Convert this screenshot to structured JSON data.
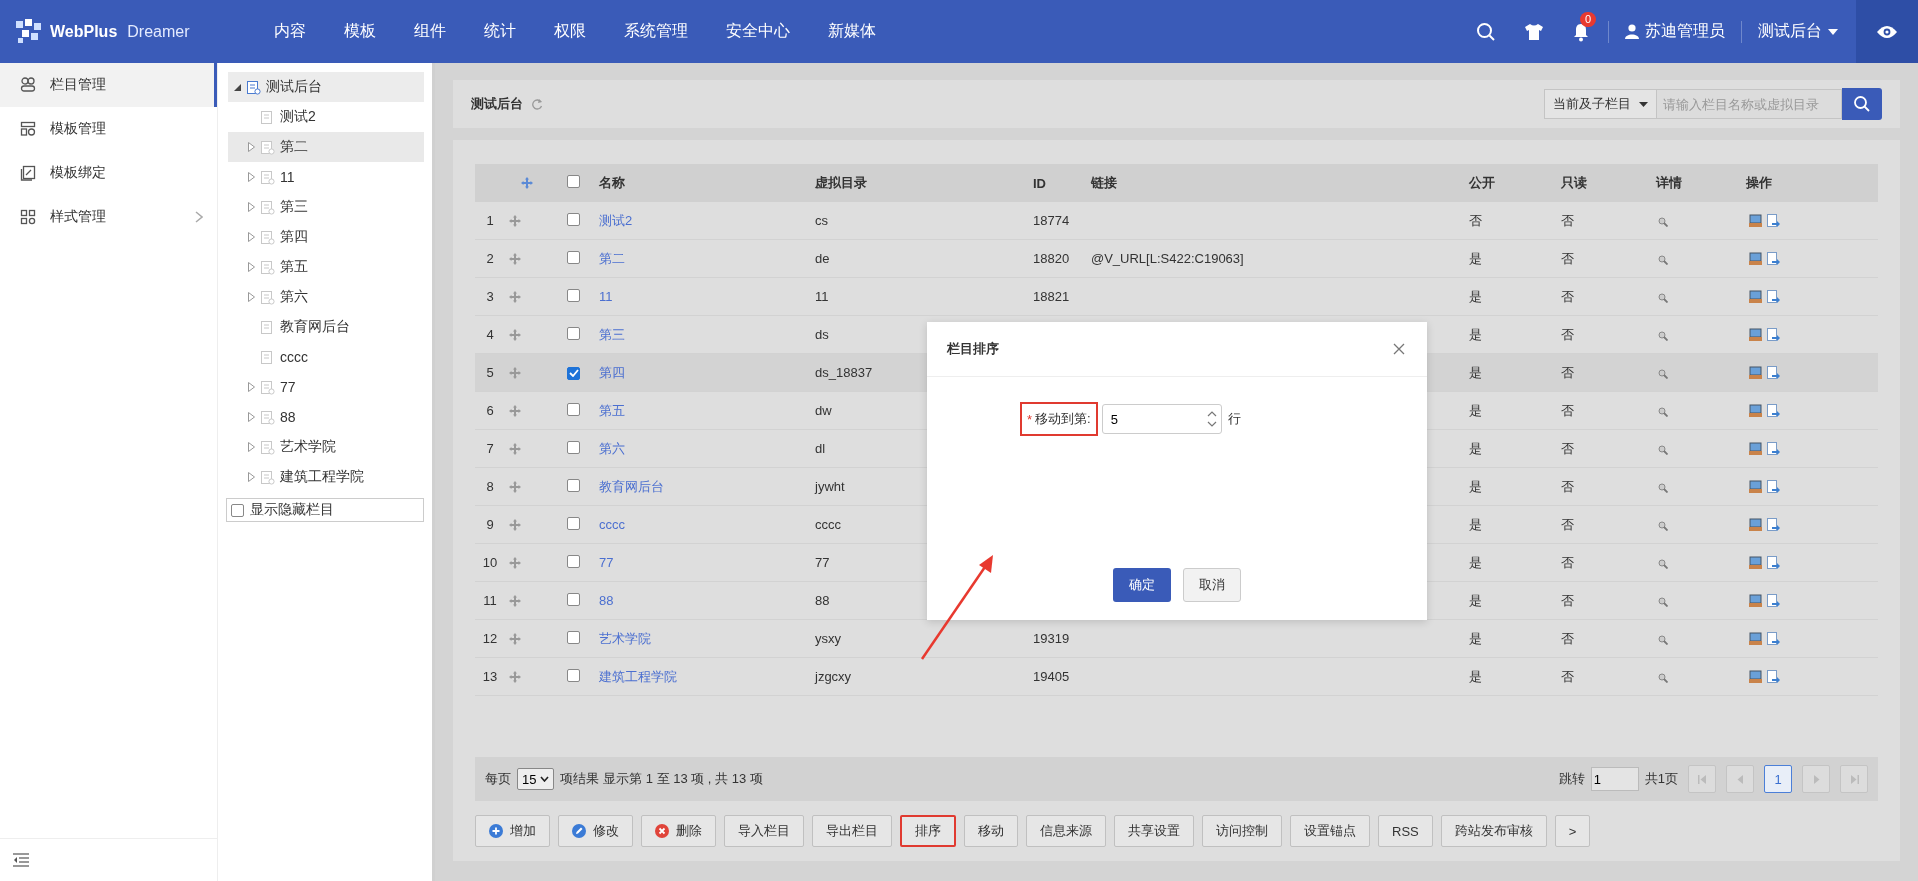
{
  "header": {
    "logo": {
      "brand": "WebPlus",
      "product": "Dreamer"
    },
    "nav": [
      {
        "label": "内容"
      },
      {
        "label": "模板"
      },
      {
        "label": "组件"
      },
      {
        "label": "统计"
      },
      {
        "label": "权限"
      },
      {
        "label": "系统管理"
      },
      {
        "label": "安全中心"
      },
      {
        "label": "新媒体"
      }
    ],
    "notification_badge": "0",
    "user": "苏迪管理员",
    "site": "测试后台"
  },
  "sidebar": {
    "items": [
      {
        "label": "栏目管理",
        "selected": true,
        "submenu": false
      },
      {
        "label": "模板管理",
        "selected": false,
        "submenu": false
      },
      {
        "label": "模板绑定",
        "selected": false,
        "submenu": false
      },
      {
        "label": "样式管理",
        "selected": false,
        "submenu": true
      }
    ]
  },
  "tree": {
    "root": {
      "label": "测试后台",
      "expanded": true,
      "selected": true,
      "children": [
        {
          "label": "测试2",
          "expandable": false,
          "hovered": false
        },
        {
          "label": "第二",
          "expandable": true,
          "hovered": true
        },
        {
          "label": "11",
          "expandable": true,
          "hovered": false
        },
        {
          "label": "第三",
          "expandable": true,
          "hovered": false
        },
        {
          "label": "第四",
          "expandable": true,
          "hovered": false
        },
        {
          "label": "第五",
          "expandable": true,
          "hovered": false
        },
        {
          "label": "第六",
          "expandable": true,
          "hovered": false
        },
        {
          "label": "教育网后台",
          "expandable": false,
          "hovered": false
        },
        {
          "label": "cccc",
          "expandable": false,
          "hovered": false
        },
        {
          "label": "77",
          "expandable": true,
          "hovered": false
        },
        {
          "label": "88",
          "expandable": true,
          "hovered": false
        },
        {
          "label": "艺术学院",
          "expandable": true,
          "hovered": false
        },
        {
          "label": "建筑工程学院",
          "expandable": true,
          "hovered": false
        }
      ]
    },
    "show_hidden": {
      "label": "显示隐藏栏目",
      "checked": false
    }
  },
  "main": {
    "title": "测试后台",
    "scope": "当前及子栏目",
    "search": {
      "placeholder": "请输入栏目名称或虚拟目录"
    },
    "table": {
      "columns": [
        "名称",
        "虚拟目录",
        "ID",
        "链接",
        "公开",
        "只读",
        "详情",
        "操作"
      ],
      "all_checked": false,
      "rows": [
        {
          "index": "1",
          "checked": false,
          "name": "测试2",
          "dir": "cs",
          "id": "18774",
          "public": "否",
          "readonly": "否"
        },
        {
          "index": "2",
          "checked": false,
          "name": "第二",
          "dir": "de",
          "id": "18820",
          "link": "@V_URL[L:S422:C19063]",
          "public": "是",
          "readonly": "否"
        },
        {
          "index": "3",
          "checked": false,
          "name": "11",
          "dir": "11",
          "id": "18821",
          "public": "是",
          "readonly": "否"
        },
        {
          "index": "4",
          "checked": false,
          "name": "第三",
          "dir": "ds",
          "public": "是",
          "readonly": "否"
        },
        {
          "index": "5",
          "checked": true,
          "name": "第四",
          "dir": "ds_18837",
          "public": "是",
          "readonly": "否"
        },
        {
          "index": "6",
          "checked": false,
          "name": "第五",
          "dir": "dw",
          "public": "是",
          "readonly": "否"
        },
        {
          "index": "7",
          "checked": false,
          "name": "第六",
          "dir": "dl",
          "public": "是",
          "readonly": "否"
        },
        {
          "index": "8",
          "checked": false,
          "name": "教育网后台",
          "dir": "jywht",
          "public": "是",
          "readonly": "否"
        },
        {
          "index": "9",
          "checked": false,
          "name": "cccc",
          "dir": "cccc",
          "public": "是",
          "readonly": "否"
        },
        {
          "index": "10",
          "checked": false,
          "name": "77",
          "dir": "77",
          "public": "是",
          "readonly": "否"
        },
        {
          "index": "11",
          "checked": false,
          "name": "88",
          "dir": "88",
          "public": "是",
          "readonly": "否"
        },
        {
          "index": "12",
          "checked": false,
          "name": "艺术学院",
          "dir": "ysxy",
          "id": "19319",
          "public": "是",
          "readonly": "否"
        },
        {
          "index": "13",
          "checked": false,
          "name": "建筑工程学院",
          "dir": "jzgcxy",
          "id": "19405",
          "public": "是",
          "readonly": "否"
        }
      ]
    },
    "pager": {
      "per_page_label": "每页",
      "per_page": "15",
      "summary": "项结果 显示第 1 至 13 项 , 共 13 项",
      "jump_label": "跳转",
      "jump_value": "1",
      "total_pages": "共1页",
      "pages": [
        {
          "label": "1",
          "selected": true
        }
      ]
    },
    "actions": [
      {
        "label": "增加",
        "kind": "add",
        "highlighted": false
      },
      {
        "label": "修改",
        "kind": "edit",
        "highlighted": false
      },
      {
        "label": "删除",
        "kind": "delete",
        "highlighted": false
      },
      {
        "label": "导入栏目",
        "kind": "plain",
        "highlighted": false
      },
      {
        "label": "导出栏目",
        "kind": "plain",
        "highlighted": false
      },
      {
        "label": "排序",
        "kind": "plain",
        "highlighted": true
      },
      {
        "label": "移动",
        "kind": "plain",
        "highlighted": false
      },
      {
        "label": "信息来源",
        "kind": "plain",
        "highlighted": false
      },
      {
        "label": "共享设置",
        "kind": "plain",
        "highlighted": false
      },
      {
        "label": "访问控制",
        "kind": "plain",
        "highlighted": false
      },
      {
        "label": "设置锚点",
        "kind": "plain",
        "highlighted": false
      },
      {
        "label": "RSS",
        "kind": "plain",
        "highlighted": false
      },
      {
        "label": "跨站发布审核",
        "kind": "plain",
        "highlighted": false
      },
      {
        "label": ">",
        "kind": "plain",
        "highlighted": false
      }
    ]
  },
  "dialog": {
    "title": "栏目排序",
    "field": {
      "label": "移动到第:",
      "required_mark": "*",
      "highlighted": true,
      "value": "5",
      "unit": "行"
    },
    "buttons": [
      {
        "label": "确定",
        "kind": "primary"
      },
      {
        "label": "取消",
        "kind": "secondary"
      }
    ]
  }
}
